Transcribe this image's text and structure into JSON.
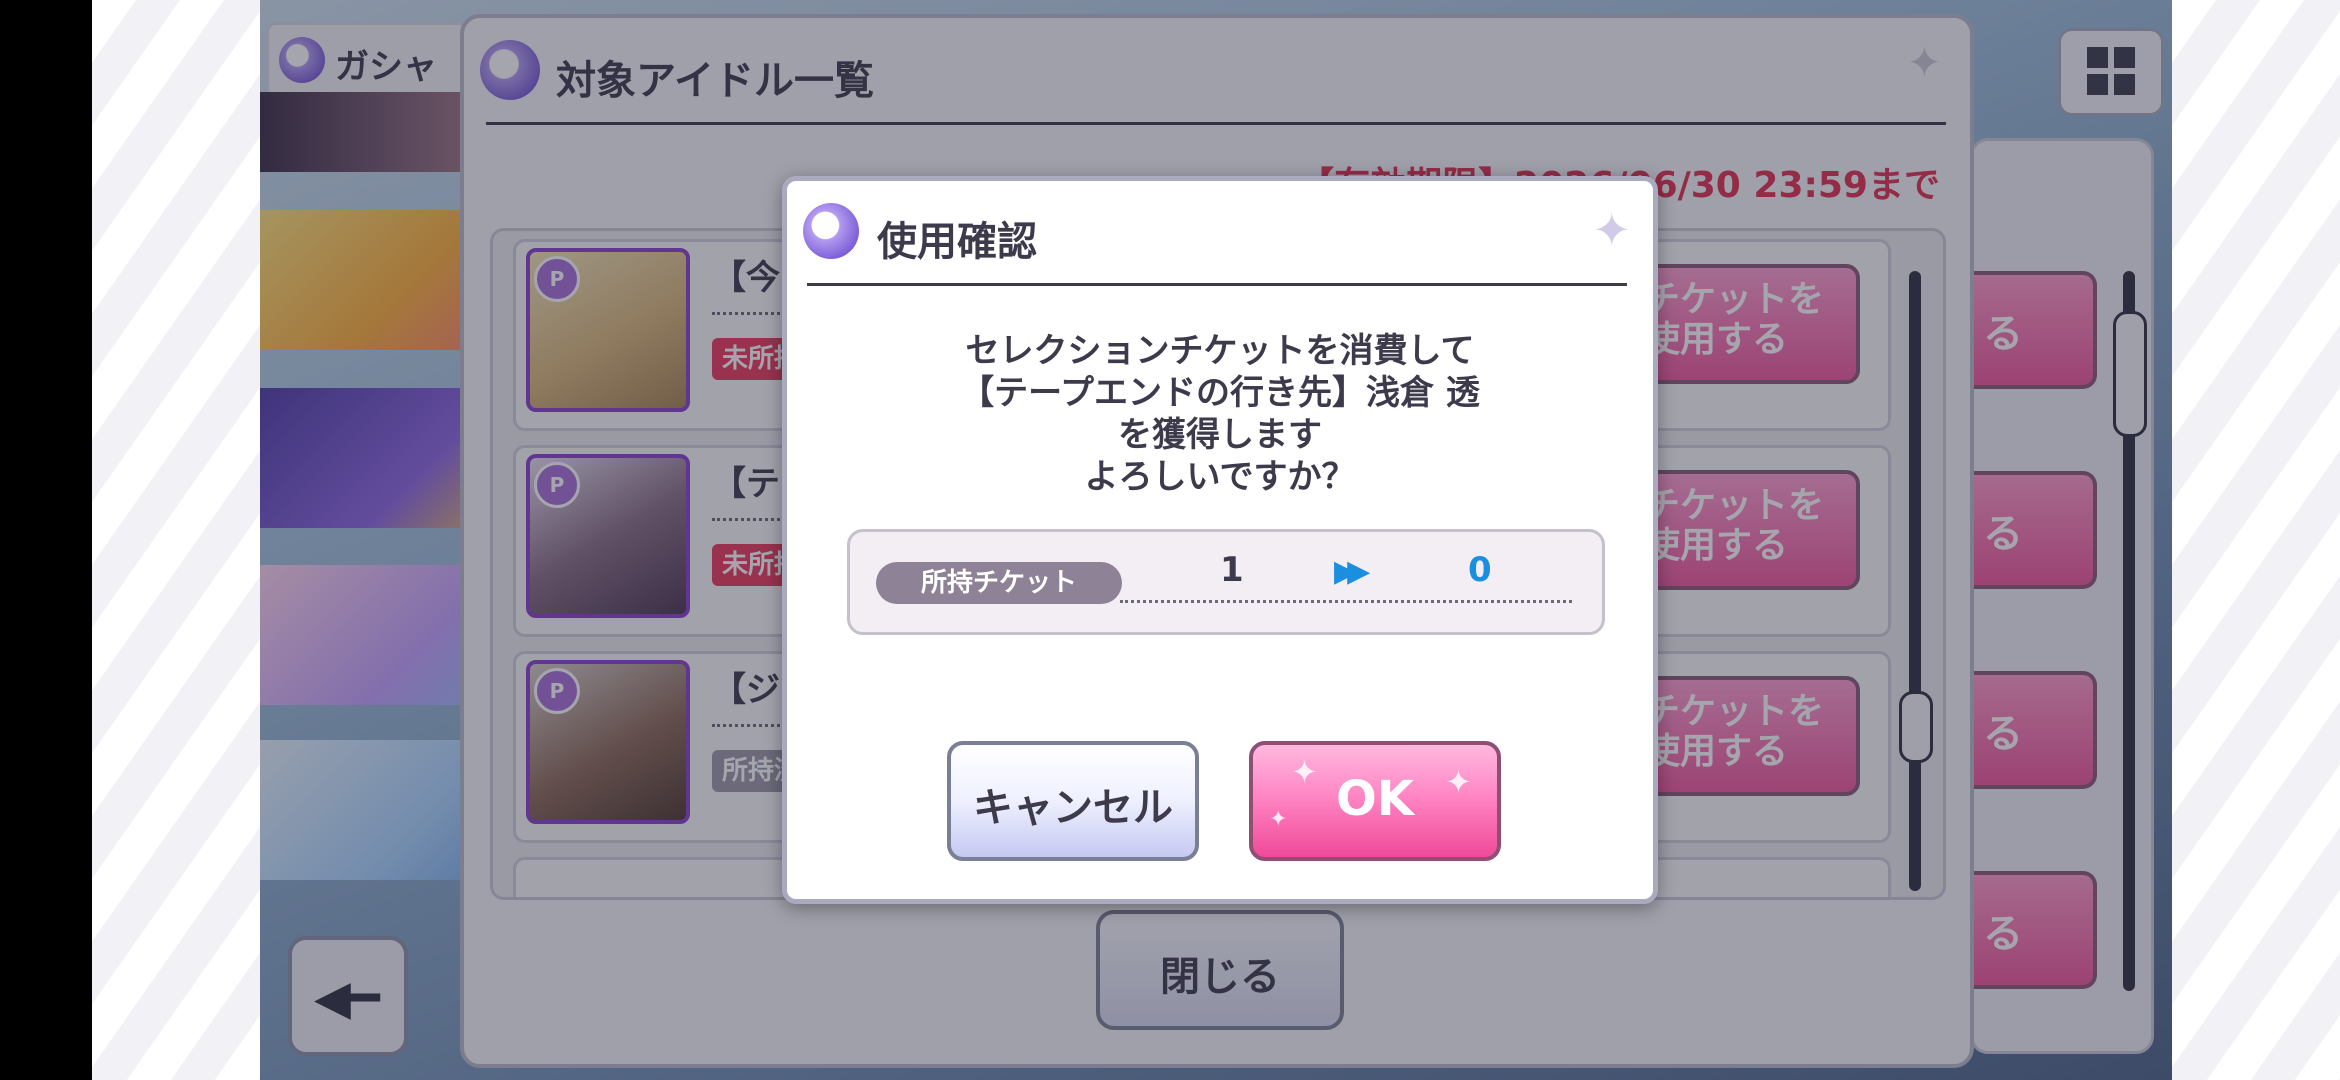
{
  "background": {
    "gacha_tab_label": "ガシャ",
    "panel": {
      "title": "対象アイドル一覧",
      "deadline": "【有効期限】2026/06/30 23:59まで",
      "rows": [
        {
          "title": "【今",
          "tag": "未所持",
          "button": "チケットを\n使用する"
        },
        {
          "title": "【テ",
          "tag": "未所持",
          "button": "チケットを\n使用する"
        },
        {
          "title": "【ジ",
          "tag": "所持済",
          "button": "チケットを\n使用する"
        }
      ],
      "close_label": "閉じる"
    },
    "right_buttons": [
      "る",
      "る",
      "る",
      "る"
    ]
  },
  "dialog": {
    "title": "使用確認",
    "message_lines": [
      "セレクションチケットを消費して",
      "【テープエンドの行き先】浅倉 透",
      "を獲得します",
      "よろしいですか？"
    ],
    "ticket": {
      "label": "所持チケット",
      "from": "1",
      "arrow_icon": "double-arrow-icon",
      "to": "0"
    },
    "cancel_label": "キャンセル",
    "ok_label": "OK"
  },
  "colors": {
    "deadline": "#e03050",
    "ok_button": "#f04a9a",
    "ticket_after": "#1a8fe0"
  }
}
